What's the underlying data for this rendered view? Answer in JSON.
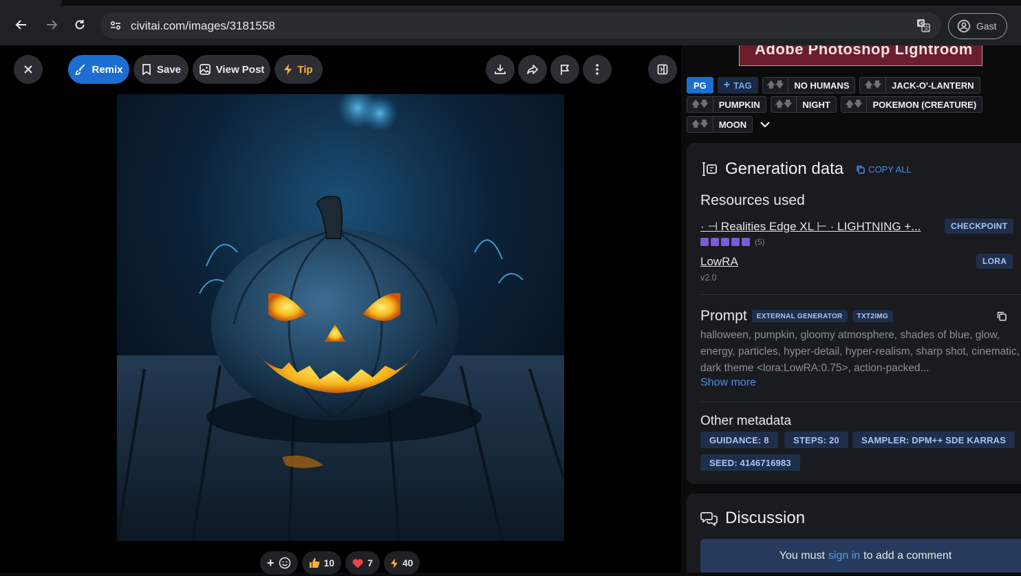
{
  "browser": {
    "url": "civitai.com/images/3181558",
    "profile_label": "Gast"
  },
  "toolbar": {
    "remix_label": "Remix",
    "save_label": "Save",
    "view_post_label": "View Post",
    "tip_label": "Tip"
  },
  "reactions": {
    "add_label": "+",
    "like_count": "10",
    "heart_count": "7",
    "buzz_count": "40"
  },
  "ad": {
    "text": "Adobe Photoshop Lightroom"
  },
  "tags": {
    "rating": "PG",
    "add_tag": "TAG",
    "items": [
      "NO HUMANS",
      "JACK-O'-LANTERN",
      "PUMPKIN",
      "NIGHT",
      "POKEMON (CREATURE)",
      "MOON"
    ]
  },
  "generation": {
    "title": "Generation data",
    "copy_all": "COPY ALL",
    "resources_title": "Resources used",
    "resources": [
      {
        "name": "· ⊣ Realities Edge XL ⊢ · LIGHTNING +...",
        "type": "CHECKPOINT",
        "rating_count": "(5)"
      },
      {
        "name": "LowRA",
        "type": "LORA",
        "version": "v2.0"
      }
    ],
    "prompt_title": "Prompt",
    "prompt_badges": [
      "EXTERNAL GENERATOR",
      "TXT2IMG"
    ],
    "prompt_text": "halloween, pumpkin, gloomy atmosphere, shades of blue, glow, energy, particles, hyper-detail, hyper-realism, sharp shot, cinematic, dark theme <lora:LowRA:0.75>, action-packed...",
    "show_more": "Show more",
    "other_title": "Other metadata",
    "meta": [
      "GUIDANCE: 8",
      "STEPS: 20",
      "SAMPLER: DPM++ SDE KARRAS",
      "SEED: 4146716983"
    ]
  },
  "discussion": {
    "title": "Discussion",
    "prefix": "You must",
    "link": "sign in",
    "suffix": "to add a comment"
  },
  "colors": {
    "accent": "#1c6ed1",
    "tip": "#f7b23b",
    "badge_bg": "#1f2f4b",
    "badge_text": "#a8c6f6"
  }
}
